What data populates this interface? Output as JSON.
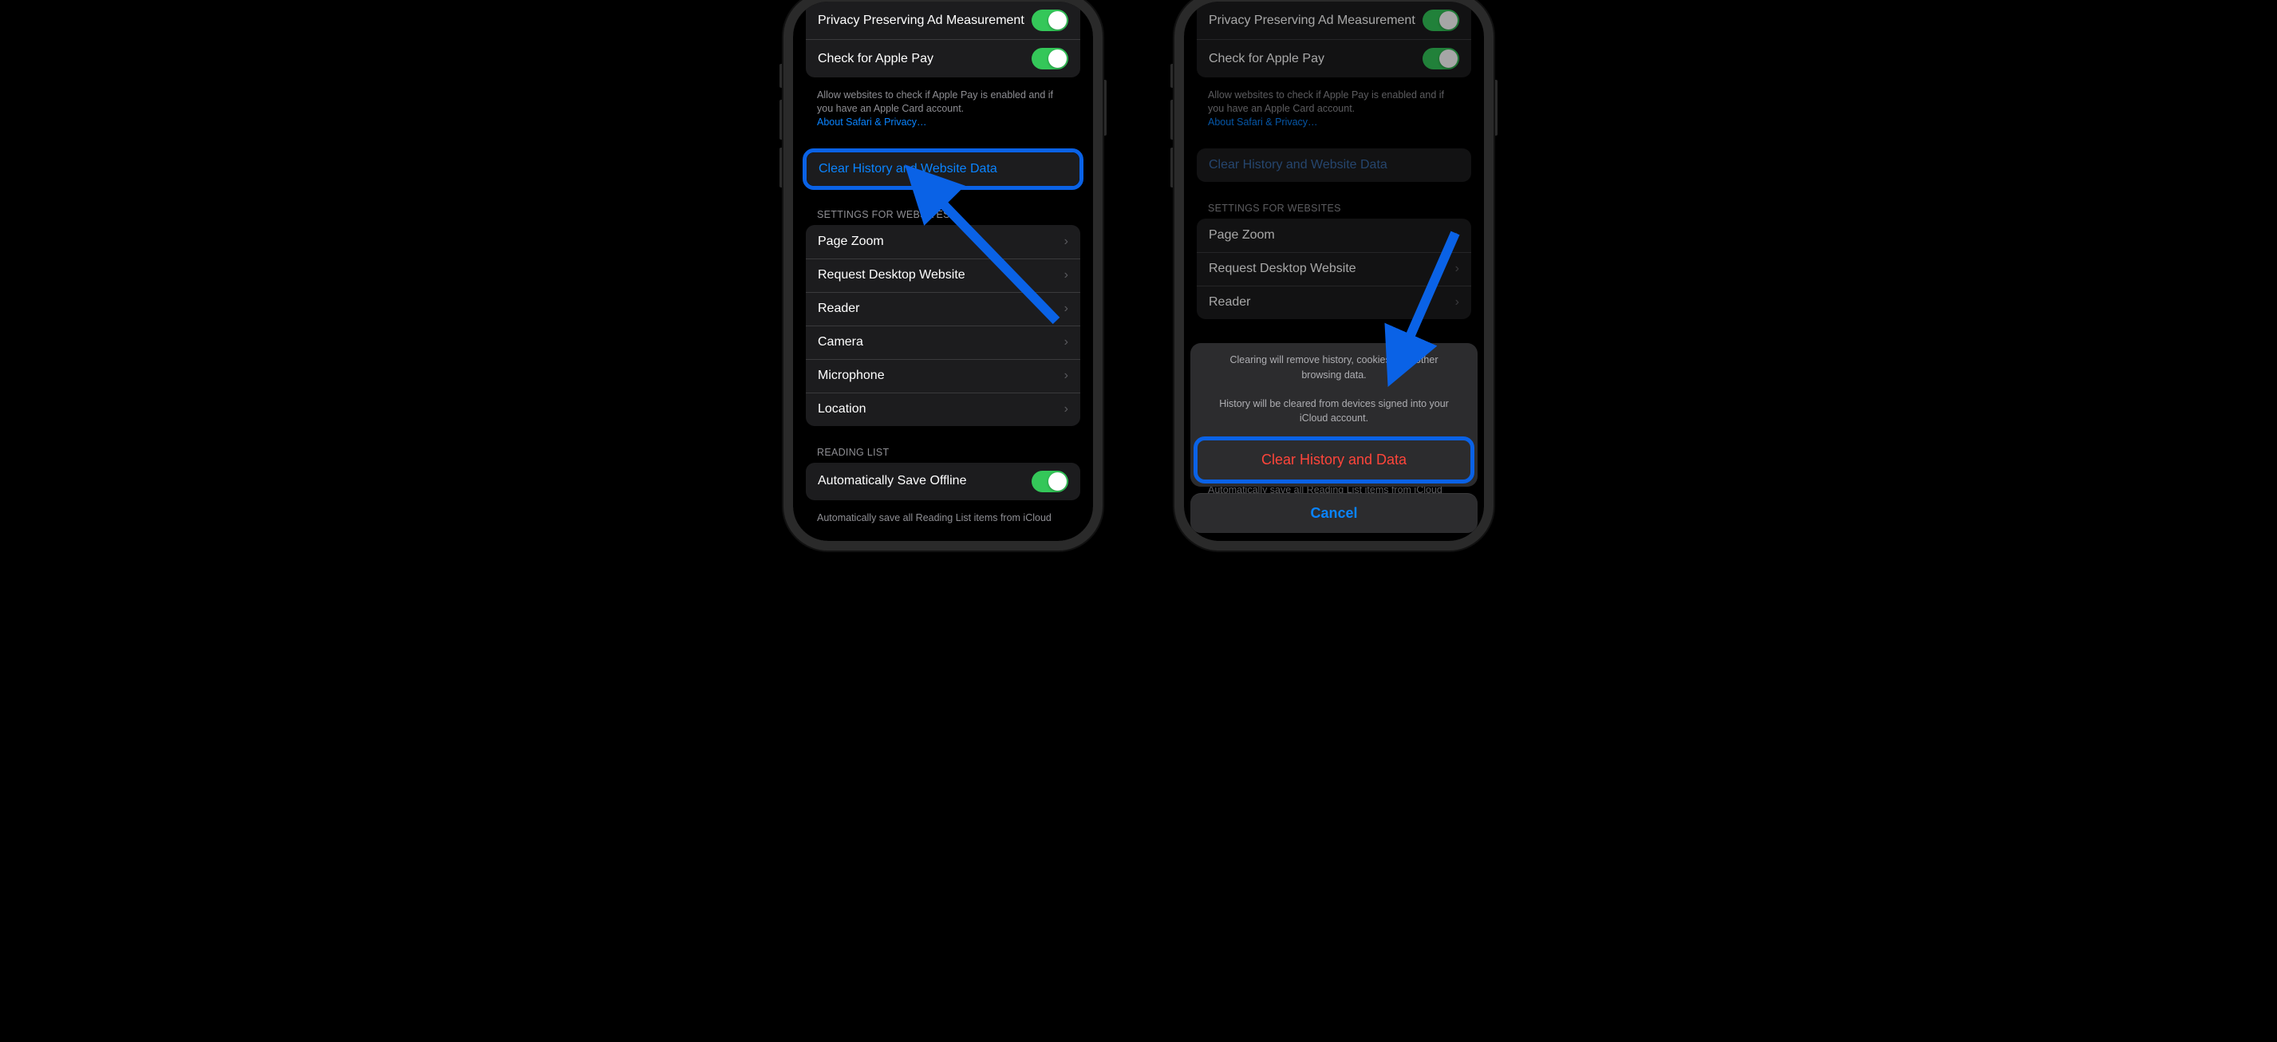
{
  "left": {
    "privacy_ad_label": "Privacy Preserving Ad Measurement",
    "apple_pay_label": "Check for Apple Pay",
    "apple_pay_note": "Allow websites to check if Apple Pay is enabled and if you have an Apple Card account.",
    "about_link": "About Safari & Privacy…",
    "clear_label": "Clear History and Website Data",
    "websites_header": "SETTINGS FOR WEBSITES",
    "website_items": [
      "Page Zoom",
      "Request Desktop Website",
      "Reader",
      "Camera",
      "Microphone",
      "Location"
    ],
    "reading_header": "READING LIST",
    "auto_save_label": "Automatically Save Offline",
    "auto_save_note": "Automatically save all Reading List items from iCloud"
  },
  "right": {
    "privacy_ad_label": "Privacy Preserving Ad Measurement",
    "apple_pay_label": "Check for Apple Pay",
    "apple_pay_note": "Allow websites to check if Apple Pay is enabled and if you have an Apple Card account.",
    "about_link": "About Safari & Privacy…",
    "clear_label": "Clear History and Website Data",
    "websites_header": "SETTINGS FOR WEBSITES",
    "website_items": [
      "Page Zoom",
      "Request Desktop Website",
      "Reader"
    ],
    "auto_save_note": "Automatically save all Reading List items from iCloud",
    "sheet": {
      "msg1": "Clearing will remove history, cookies, and other browsing data.",
      "msg2": "History will be cleared from devices signed into your iCloud account.",
      "destructive": "Clear History and Data",
      "cancel": "Cancel"
    }
  },
  "colors": {
    "toggle_on": "#34c759",
    "link_blue": "#0a84ff",
    "highlight_blue": "#0a62e6",
    "destructive": "#ff453a"
  }
}
